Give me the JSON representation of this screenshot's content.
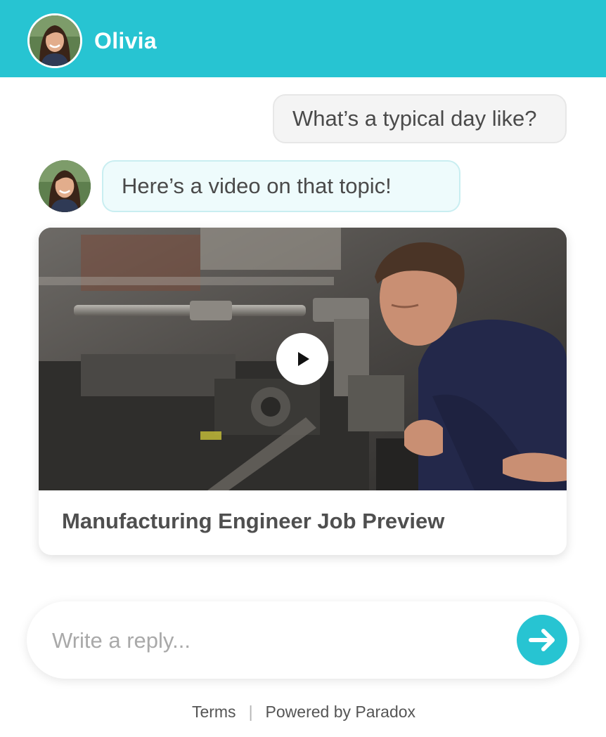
{
  "header": {
    "agent_name": "Olivia",
    "avatar_icon": "assistant-avatar-icon",
    "background_color": "#27c4d2"
  },
  "messages": [
    {
      "sender": "user",
      "text": "What’s a typical day like?"
    },
    {
      "sender": "bot",
      "text": "Here’s a video on that topic!"
    }
  ],
  "video_card": {
    "title": "Manufacturing Engineer Job Preview",
    "play_icon": "play-icon"
  },
  "composer": {
    "placeholder": "Write a reply...",
    "value": "",
    "send_icon": "arrow-right-icon"
  },
  "footer": {
    "terms_label": "Terms",
    "separator": "|",
    "powered_by_label": "Powered by Paradox"
  },
  "colors": {
    "accent": "#27c4d2",
    "user_bubble": "#f4f4f4",
    "bot_bubble": "#eefbfc"
  }
}
